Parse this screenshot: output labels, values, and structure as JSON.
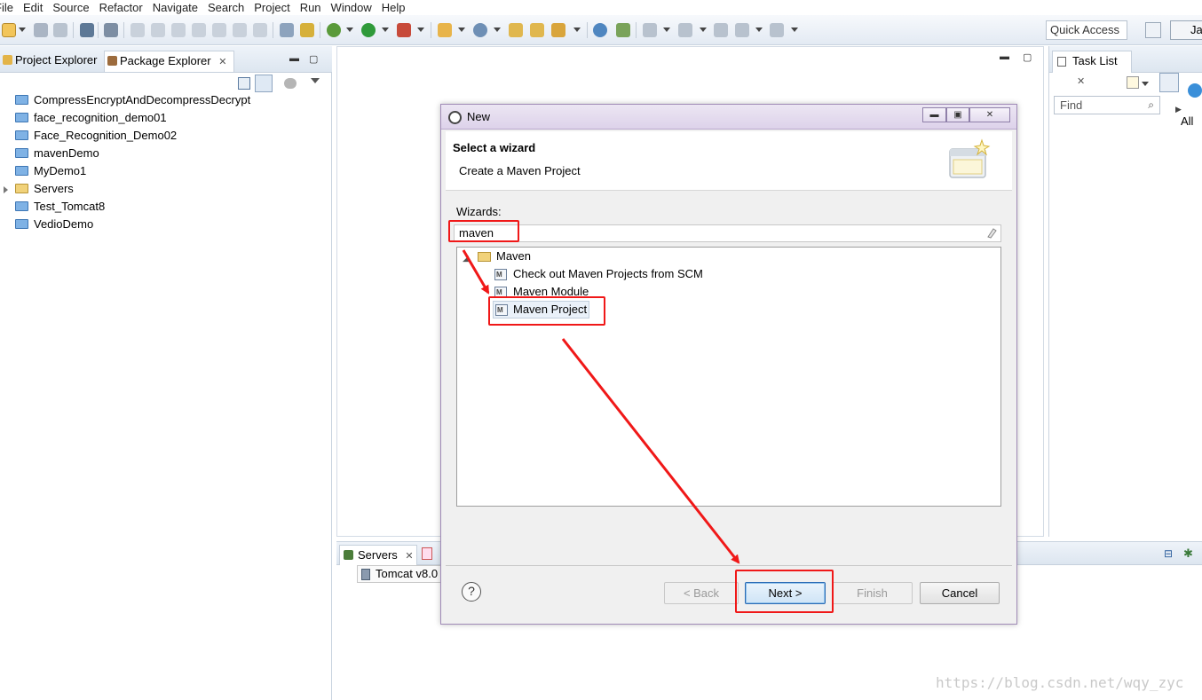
{
  "menu": [
    "File",
    "Edit",
    "Source",
    "Refactor",
    "Navigate",
    "Search",
    "Project",
    "Run",
    "Window",
    "Help"
  ],
  "quick_access": "Quick Access",
  "perspective_label": "Ja",
  "left_view": {
    "tabs": [
      "Project Explorer",
      "Package Explorer"
    ],
    "projects": [
      "CompressEncryptAndDecompressDecrypt",
      "face_recognition_demo01",
      "Face_Recognition_Demo02",
      "mavenDemo",
      "MyDemo1",
      "Servers",
      "Test_Tomcat8",
      "VedioDemo"
    ]
  },
  "right_view": {
    "tab": "Task List",
    "find_placeholder": "Find",
    "all_label": "All"
  },
  "bottom_view": {
    "tab": "Servers",
    "server": "Tomcat v8.0"
  },
  "dialog": {
    "title": "New",
    "header_title": "Select a wizard",
    "header_desc": "Create a Maven Project",
    "wizards_label": "Wizards:",
    "filter_value": "maven",
    "tree": {
      "category": "Maven",
      "items": [
        "Check out Maven Projects from SCM",
        "Maven Module",
        "Maven Project"
      ]
    },
    "buttons": {
      "help": "?",
      "back": "< Back",
      "next": "Next >",
      "finish": "Finish",
      "cancel": "Cancel"
    }
  },
  "watermark": "https://blog.csdn.net/wqy_zyc",
  "colors": {
    "annotation_red": "#f01818",
    "folder_blue": "#7fb2e5",
    "dialog_border": "#a08bb7"
  }
}
